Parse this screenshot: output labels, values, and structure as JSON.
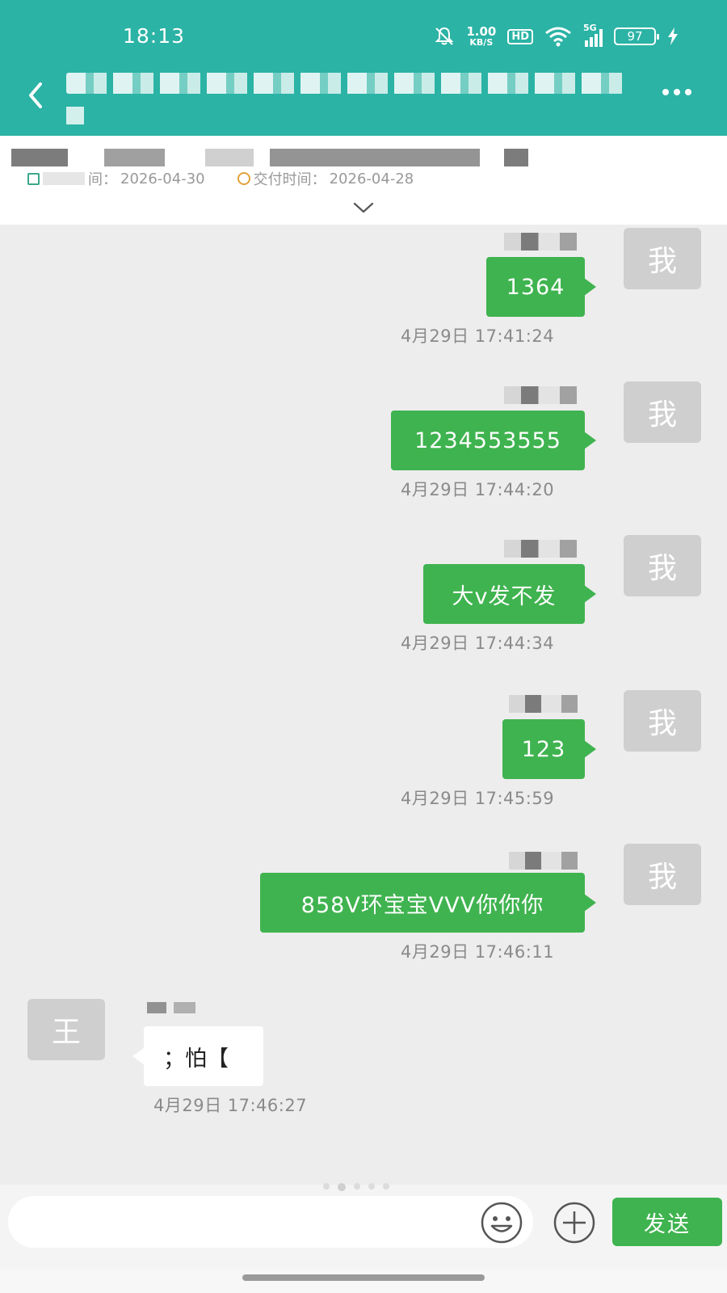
{
  "status_bar": {
    "time": "18:13",
    "net_speed_value": "1.00",
    "net_speed_unit": "KB/S",
    "hd": "HD",
    "signal_label": "5G",
    "battery": "97"
  },
  "nav": {
    "title": "",
    "back_icon": "chevron-left-icon",
    "more_icon": "more-horizontal-icon"
  },
  "info": {
    "start_label": "间：",
    "start_date": "2026-04-30",
    "delivery_label": "交付时间：",
    "delivery_date": "2026-04-28"
  },
  "messages": [
    {
      "direction": "out",
      "avatar": "我",
      "text": "1364",
      "time": "4月29日 17:41:24"
    },
    {
      "direction": "out",
      "avatar": "我",
      "text": "1234553555",
      "time": "4月29日 17:44:20"
    },
    {
      "direction": "out",
      "avatar": "我",
      "text": "大v发不发",
      "time": "4月29日 17:44:34"
    },
    {
      "direction": "out",
      "avatar": "我",
      "text": "123",
      "time": "4月29日 17:45:59"
    },
    {
      "direction": "out",
      "avatar": "我",
      "text": "858V环宝宝VVV你你你",
      "time": "4月29日 17:46:11"
    },
    {
      "direction": "in",
      "avatar": "王",
      "text": "；怕【",
      "time": "4月29日 17:46:27"
    }
  ],
  "composer": {
    "placeholder": "",
    "emoji_icon": "smile-icon",
    "plus_icon": "plus-circle-icon",
    "send_label": "发送"
  },
  "colors": {
    "header": "#2bb3a5",
    "bubble_out": "#3fb34f",
    "send_button": "#3fb34f",
    "background": "#ededed"
  }
}
